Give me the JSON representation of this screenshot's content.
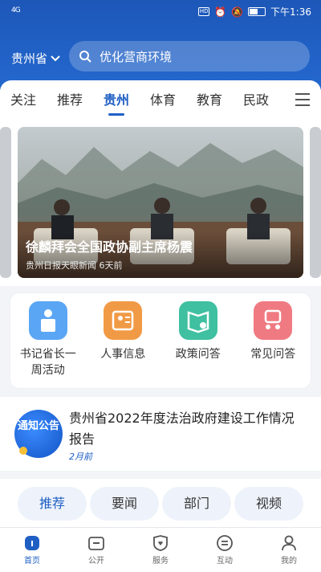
{
  "status_bar": {
    "signal": "4G",
    "time": "下午1:36",
    "hd": "HD"
  },
  "header": {
    "region": "贵州省",
    "search_text": "优化营商环境"
  },
  "tabs": [
    {
      "label": "关注"
    },
    {
      "label": "推荐"
    },
    {
      "label": "贵州",
      "active": true
    },
    {
      "label": "体育"
    },
    {
      "label": "教育"
    },
    {
      "label": "民政"
    }
  ],
  "carousel": {
    "title": "徐麟拜会全国政协副主席杨震",
    "meta": "贵州日报天眼新闻 6天前"
  },
  "quick_links": [
    {
      "label": "书记省长一周活动",
      "icon": "podium-icon",
      "color": "#5aa6f5"
    },
    {
      "label": "人事信息",
      "icon": "person-card-icon",
      "color": "#f19a45"
    },
    {
      "label": "政策问答",
      "icon": "policy-book-icon",
      "color": "#3fc0a0"
    },
    {
      "label": "常见问答",
      "icon": "faq-people-icon",
      "color": "#f07a82"
    }
  ],
  "notice": {
    "badge": "通知公告",
    "title": "贵州省2022年度法治政府建设工作情况报告",
    "time": "2月前"
  },
  "pills": [
    {
      "label": "推荐",
      "active": true
    },
    {
      "label": "要闻"
    },
    {
      "label": "部门"
    },
    {
      "label": "视频"
    }
  ],
  "bottom_nav": [
    {
      "label": "首页",
      "active": true
    },
    {
      "label": "公开"
    },
    {
      "label": "服务"
    },
    {
      "label": "互动"
    },
    {
      "label": "我的"
    }
  ]
}
